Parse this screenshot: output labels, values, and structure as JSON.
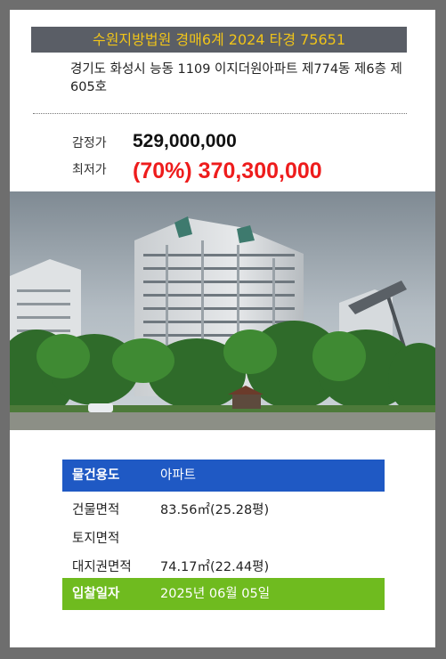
{
  "listing": {
    "court_case": "수원지방법원 경매6계 2024 타경 75651",
    "address": "경기도 화성시 능동 1109 이지더원아파트 제774동 제6층 제605호",
    "appraisal_label": "감정가",
    "appraisal_value": "529,000,000",
    "minimum_label": "최저가",
    "minimum_value": "(70%) 370,300,000"
  },
  "details": {
    "property_type_label": "물건용도",
    "property_type_value": "아파트",
    "building_area_label": "건물면적",
    "building_area_value": "83.56㎡(25.28평)",
    "land_area_label": "토지면적",
    "land_area_value": "",
    "land_right_area_label": "대지권면적",
    "land_right_area_value": "74.17㎡(22.44평)",
    "bid_date_label": "입찰일자",
    "bid_date_value": "2025년 06월 05일"
  },
  "colors": {
    "court_bar_bg": "#5a5e66",
    "court_bar_text": "#f0c419",
    "minimum_price": "#ee1c1c",
    "property_type_bg": "#1f59c4",
    "bid_date_bg": "#6fbb1f"
  }
}
